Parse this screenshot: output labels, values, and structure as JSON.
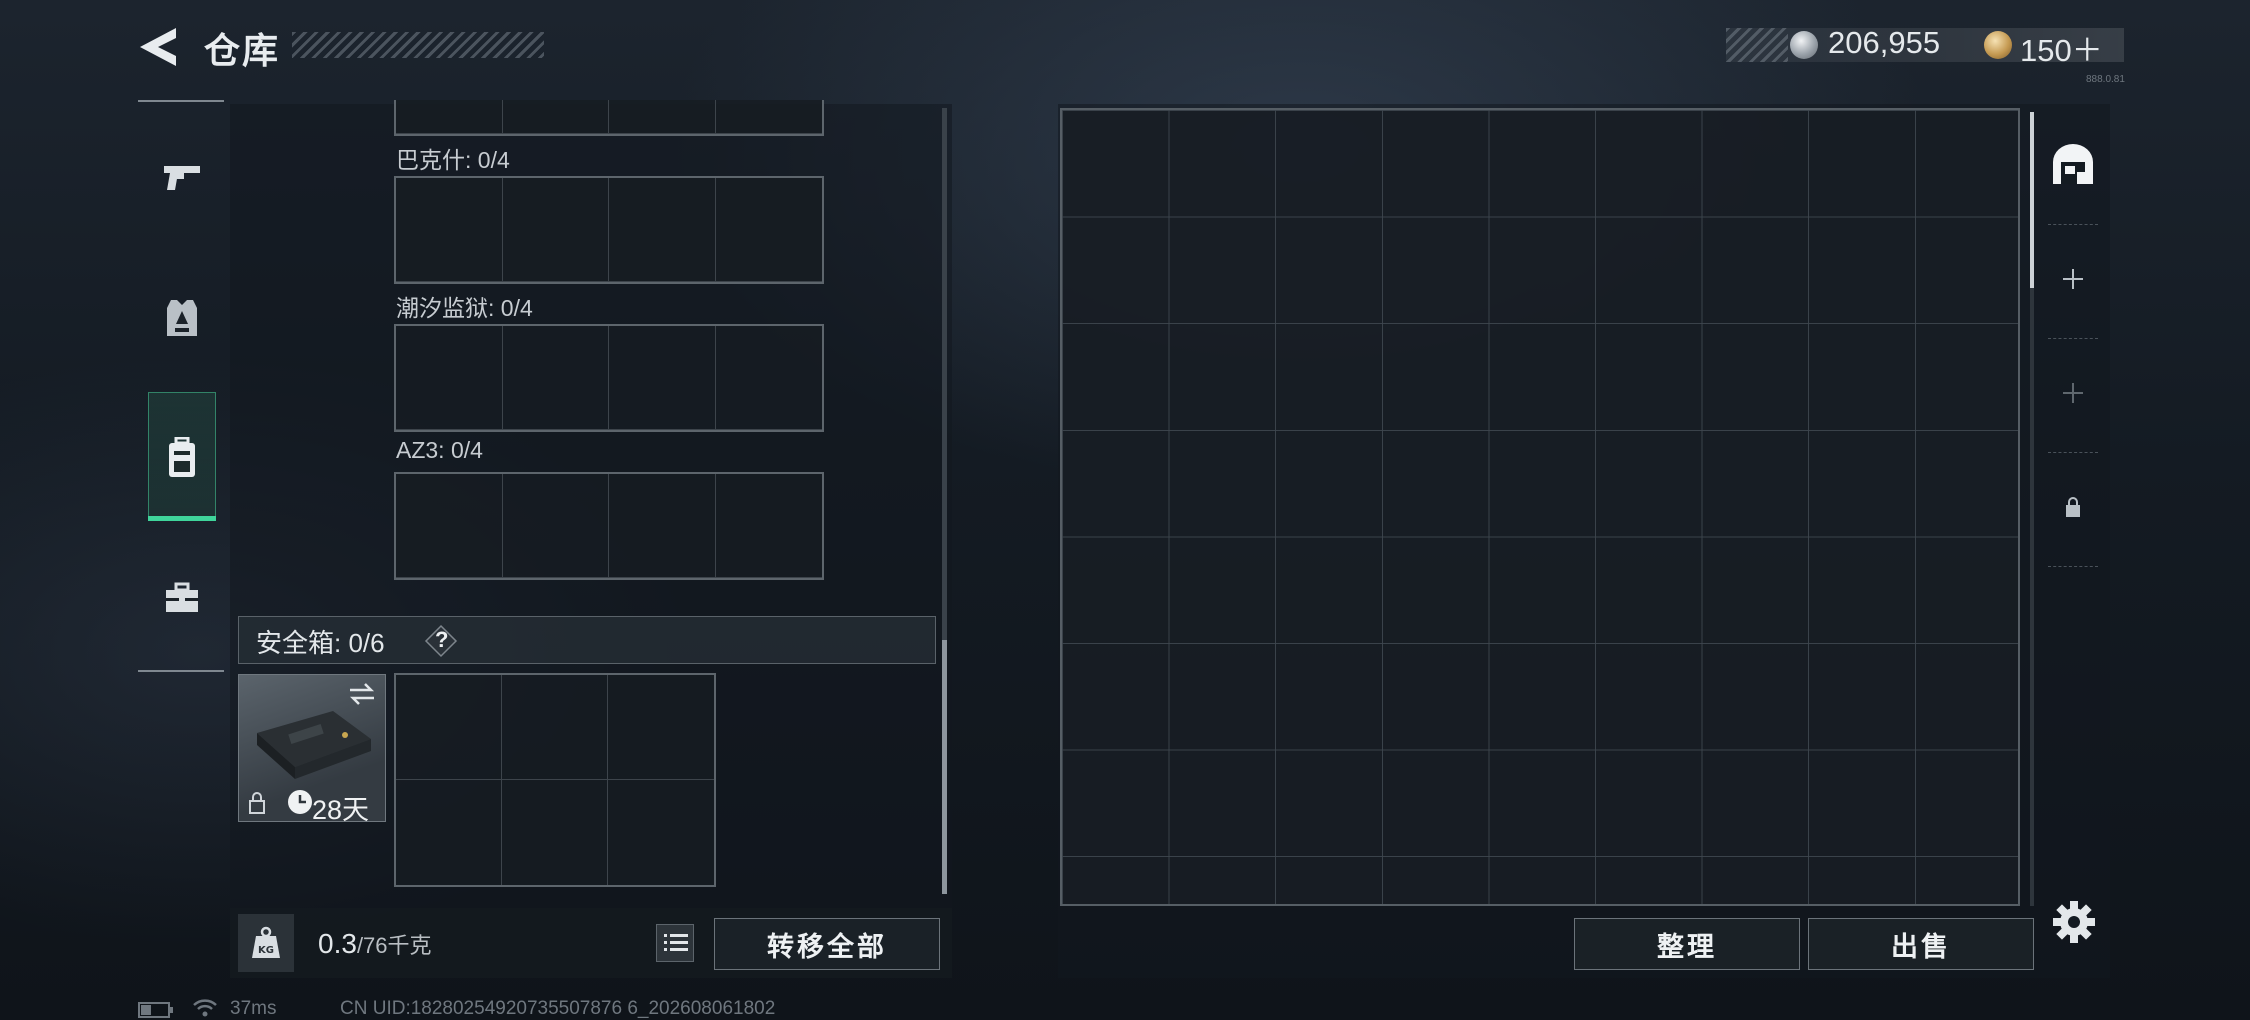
{
  "header": {
    "title": "仓库",
    "currency_silver": "206,955",
    "currency_gold": "150＋",
    "tiny_text": "888.0.81"
  },
  "left_rail": {
    "items": [
      {
        "name": "weapons",
        "icon": "pistol-icon"
      },
      {
        "name": "armor",
        "icon": "armor-vest-icon"
      },
      {
        "name": "backpack",
        "icon": "backpack-icon",
        "active": true
      },
      {
        "name": "equipment",
        "icon": "toolbox-icon"
      }
    ]
  },
  "slots": [
    {
      "label": "巴克什: 0/4"
    },
    {
      "label": "潮汐监狱: 0/4"
    },
    {
      "label": "AZ3: 0/4"
    }
  ],
  "safebox": {
    "label": "安全箱: 0/6",
    "help": "?",
    "card_time": "28天"
  },
  "weight": {
    "current": "0.3",
    "max": "/76千克"
  },
  "buttons": {
    "transfer_all": "转移全部",
    "sort": "整理",
    "sell": "出售"
  },
  "status": {
    "ping": "37ms",
    "uid": "CN UID:18280254920735507876 6_202608061802"
  }
}
